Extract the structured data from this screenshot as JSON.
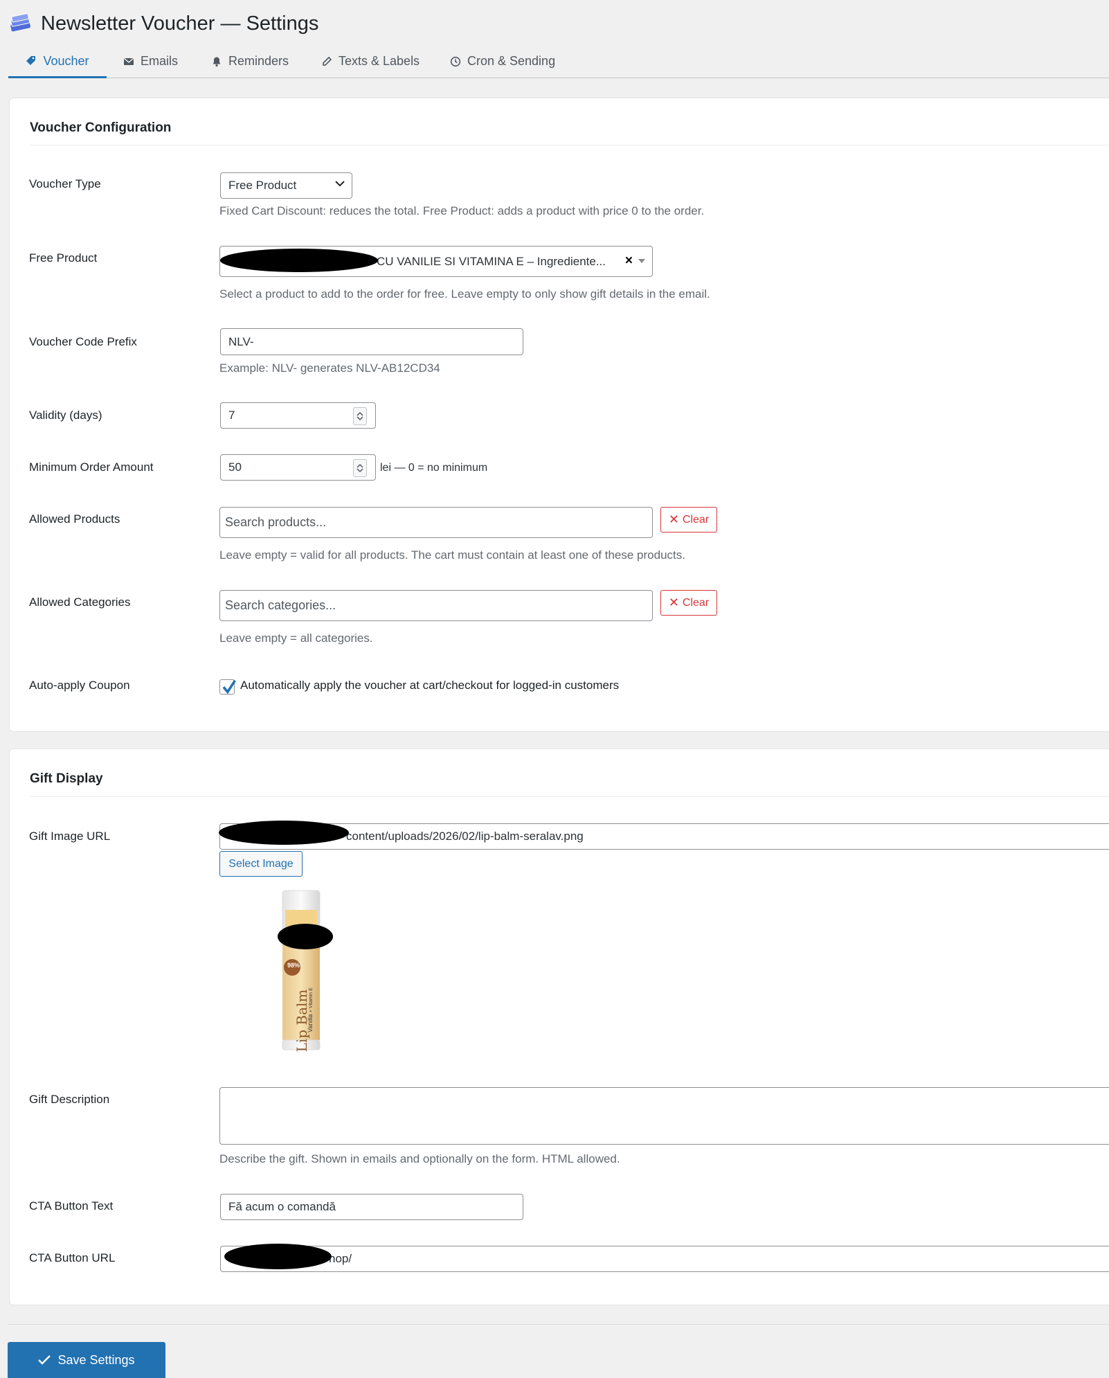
{
  "header": {
    "title": "Newsletter Voucher — Settings",
    "icon": "ticket-stack-icon"
  },
  "tabs": [
    {
      "label": "Voucher",
      "icon": "tag-icon",
      "active": true
    },
    {
      "label": "Emails",
      "icon": "envelope-icon",
      "active": false
    },
    {
      "label": "Reminders",
      "icon": "bell-icon",
      "active": false
    },
    {
      "label": "Texts & Labels",
      "icon": "pencil-icon",
      "active": false
    },
    {
      "label": "Cron & Sending",
      "icon": "clock-icon",
      "active": false
    }
  ],
  "voucher": {
    "title": "Voucher Configuration",
    "type": {
      "label": "Voucher Type",
      "value": "Free Product",
      "desc": "Fixed Cart Discount: reduces the total. Free Product: adds a product with price 0 to the order."
    },
    "free_product": {
      "label": "Free Product",
      "value": "CU VANILIE SI VITAMINA E – Ingrediente...",
      "desc": "Select a product to add to the order for free. Leave empty to only show gift details in the email."
    },
    "prefix": {
      "label": "Voucher Code Prefix",
      "value": "NLV-",
      "desc": "Example: NLV- generates NLV-AB12CD34"
    },
    "validity": {
      "label": "Validity (days)",
      "value": "7"
    },
    "min_order": {
      "label": "Minimum Order Amount",
      "value": "50",
      "suffix": "lei — 0 = no minimum"
    },
    "allowed_products": {
      "label": "Allowed Products",
      "placeholder": "Search products...",
      "clear": "Clear",
      "desc": "Leave empty = valid for all products. The cart must contain at least one of these products."
    },
    "allowed_categories": {
      "label": "Allowed Categories",
      "placeholder": "Search categories...",
      "clear": "Clear",
      "desc": "Leave empty = all categories."
    },
    "auto_apply": {
      "label": "Auto-apply Coupon",
      "checked": true,
      "text": "Automatically apply the voucher at cart/checkout for logged-in customers"
    }
  },
  "gift": {
    "title": "Gift Display",
    "image_url": {
      "label": "Gift Image URL",
      "value": "content/uploads/2026/02/lip-balm-seralav.png",
      "button": "Select Image"
    },
    "image": {
      "label_text": "Lip Balm",
      "sub_text": "Vanilla",
      "vit_text": "+ Vitamin E",
      "badge": "98%"
    },
    "description": {
      "label": "Gift Description",
      "value": "",
      "desc": "Describe the gift. Shown in emails and optionally on the form. HTML allowed."
    },
    "cta_text": {
      "label": "CTA Button Text",
      "value": "Fă acum o comandă"
    },
    "cta_url": {
      "label": "CTA Button URL",
      "value": "hop/"
    }
  },
  "save_label": "Save Settings",
  "colors": {
    "accent": "#2271b1",
    "danger": "#d63638",
    "muted": "#646970",
    "bg": "#f0f0f1"
  }
}
